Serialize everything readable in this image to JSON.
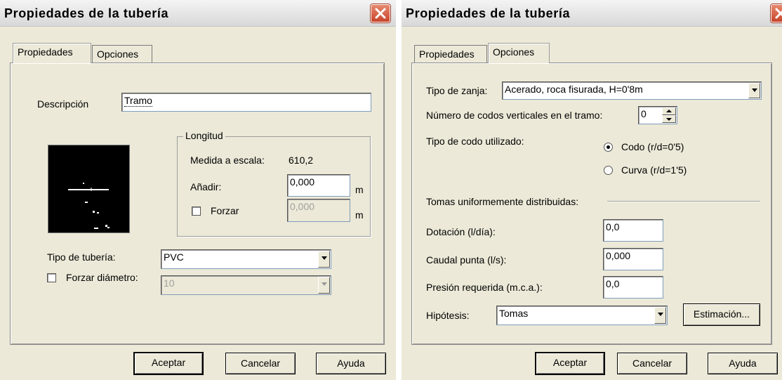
{
  "left_dialog": {
    "title": "Propiedades de la tubería",
    "tabs": [
      "Propiedades",
      "Opciones"
    ],
    "descripcion_label": "Descripción",
    "descripcion_value": "Tramo",
    "longitud_legend": "Longitud",
    "medida_label": "Medida a escala:",
    "medida_value": "610,2",
    "anadir_label": "Añadir:",
    "anadir_value": "0,000",
    "anadir_unit": "m",
    "forzar_label": "Forzar",
    "forzar_value": "0,000",
    "forzar_unit": "m",
    "tipo_tuberia_label": "Tipo de tubería:",
    "tipo_tuberia_value": "PVC",
    "forzar_diametro_label": "Forzar diámetro:",
    "forzar_diametro_value": "10",
    "buttons": {
      "accept": "Aceptar",
      "cancel": "Cancelar",
      "help": "Ayuda"
    }
  },
  "right_dialog": {
    "title": "Propiedades de la tubería",
    "tabs": [
      "Propiedades",
      "Opciones"
    ],
    "tipo_zanja_label": "Tipo de zanja:",
    "tipo_zanja_value": "Acerado, roca fisurada, H=0'8m",
    "num_codos_label": "Número de codos verticales en el tramo:",
    "num_codos_value": "0",
    "tipo_codo_label": "Tipo de codo utilizado:",
    "codo_option": "Codo (r/d=0'5)",
    "curva_option": "Curva (r/d=1'5)",
    "tomas_section": "Tomas uniformemente distribuidas:",
    "dotacion_label": "Dotación (l/día):",
    "dotacion_value": "0,0",
    "caudal_label": "Caudal punta (l/s):",
    "caudal_value": "0,000",
    "presion_label": "Presión requerida (m.c.a.):",
    "presion_value": "0,0",
    "hipotesis_label": "Hipótesis:",
    "hipotesis_value": "Tomas",
    "estimacion_button": "Estimación...",
    "buttons": {
      "accept": "Aceptar",
      "cancel": "Cancelar",
      "help": "Ayuda"
    }
  },
  "colors": {
    "dialog_bg": "#ece9d8",
    "close_button": "#c8442a",
    "preview_bg": "#000000"
  }
}
